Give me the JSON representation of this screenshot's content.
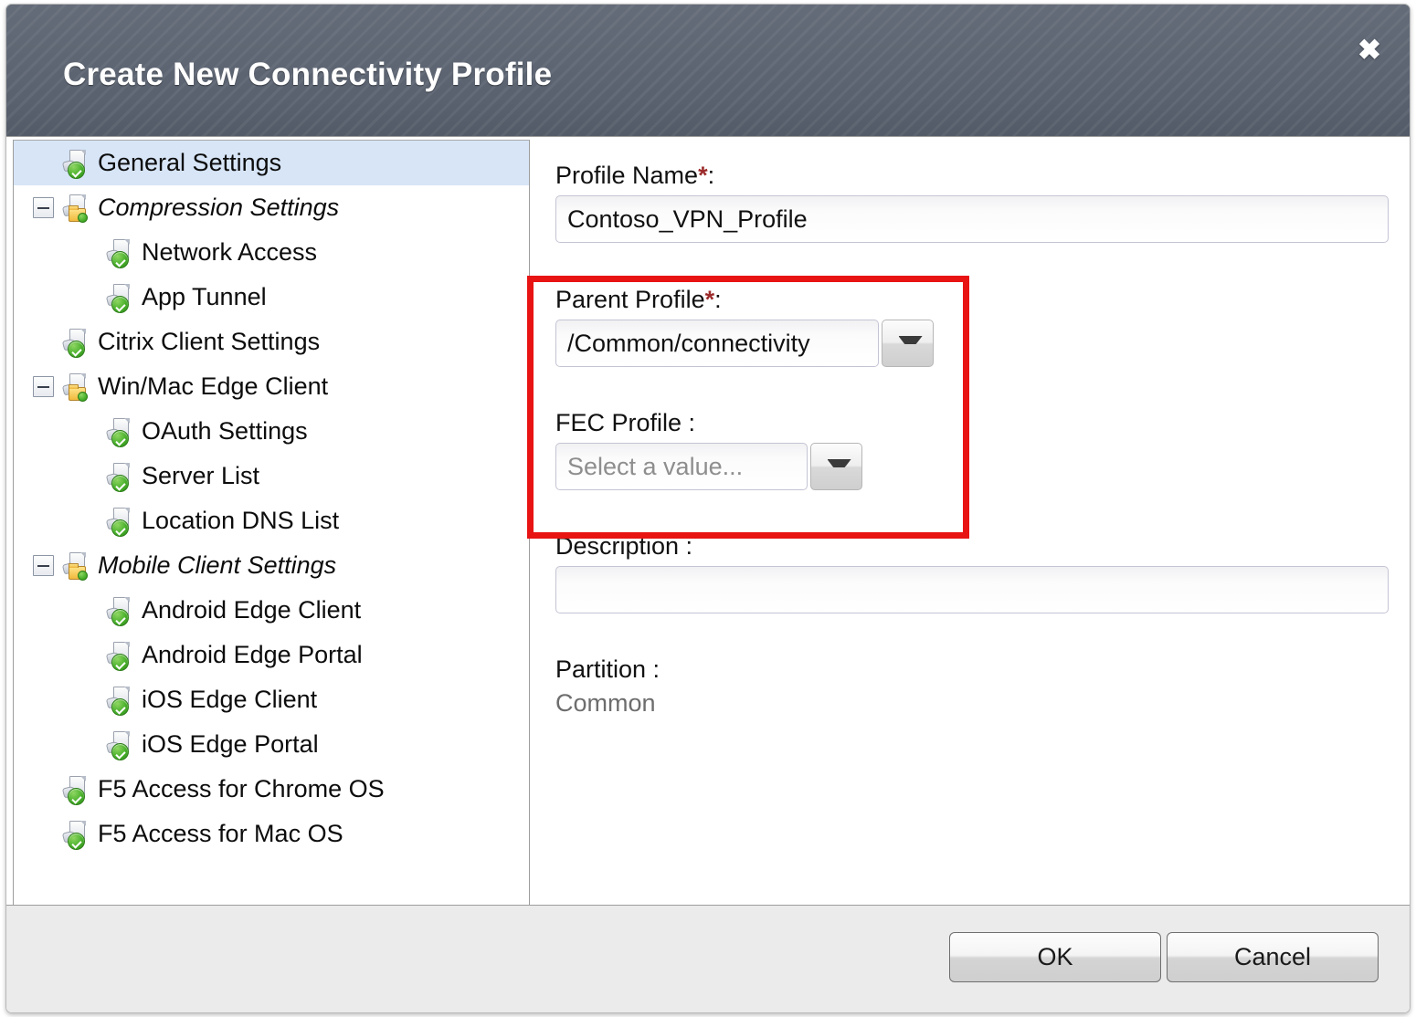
{
  "dialog": {
    "title": "Create New Connectivity Profile",
    "close_icon": "close-x-icon"
  },
  "tree": {
    "items": [
      {
        "label": "General Settings",
        "indent": 0,
        "icon": "page-check-icon",
        "expander": null,
        "selected": true,
        "italic": false
      },
      {
        "label": "Compression Settings",
        "indent": 0,
        "icon": "page-folder-icon",
        "expander": "minus",
        "selected": false,
        "italic": true
      },
      {
        "label": "Network Access",
        "indent": 1,
        "icon": "page-check-icon",
        "expander": null,
        "selected": false,
        "italic": false
      },
      {
        "label": "App Tunnel",
        "indent": 1,
        "icon": "page-check-icon",
        "expander": null,
        "selected": false,
        "italic": false
      },
      {
        "label": "Citrix Client Settings",
        "indent": 0,
        "icon": "page-check-icon",
        "expander": null,
        "selected": false,
        "italic": false
      },
      {
        "label": "Win/Mac Edge Client",
        "indent": 0,
        "icon": "page-folder-icon",
        "expander": "minus",
        "selected": false,
        "italic": false
      },
      {
        "label": "OAuth Settings",
        "indent": 1,
        "icon": "page-check-icon",
        "expander": null,
        "selected": false,
        "italic": false
      },
      {
        "label": "Server List",
        "indent": 1,
        "icon": "page-check-icon",
        "expander": null,
        "selected": false,
        "italic": false
      },
      {
        "label": "Location DNS List",
        "indent": 1,
        "icon": "page-check-icon",
        "expander": null,
        "selected": false,
        "italic": false
      },
      {
        "label": "Mobile Client Settings",
        "indent": 0,
        "icon": "page-folder-icon",
        "expander": "minus",
        "selected": false,
        "italic": true
      },
      {
        "label": "Android Edge Client",
        "indent": 1,
        "icon": "page-check-icon",
        "expander": null,
        "selected": false,
        "italic": false
      },
      {
        "label": "Android Edge Portal",
        "indent": 1,
        "icon": "page-check-icon",
        "expander": null,
        "selected": false,
        "italic": false
      },
      {
        "label": "iOS Edge Client",
        "indent": 1,
        "icon": "page-check-icon",
        "expander": null,
        "selected": false,
        "italic": false
      },
      {
        "label": "iOS Edge Portal",
        "indent": 1,
        "icon": "page-check-icon",
        "expander": null,
        "selected": false,
        "italic": false
      },
      {
        "label": "F5 Access for Chrome OS",
        "indent": 0,
        "icon": "page-check-icon",
        "expander": null,
        "selected": false,
        "italic": false
      },
      {
        "label": "F5 Access for Mac OS",
        "indent": 0,
        "icon": "page-check-icon",
        "expander": null,
        "selected": false,
        "italic": false
      }
    ]
  },
  "form": {
    "profile_name": {
      "label": "Profile Name",
      "required_mark": "*",
      "colon": ":",
      "value": "Contoso_VPN_Profile"
    },
    "parent_profile": {
      "label": "Parent Profile",
      "required_mark": "*",
      "colon": ":",
      "value": "/Common/connectivity",
      "dropdown_icon": "chevron-down-icon"
    },
    "fec_profile": {
      "label": "FEC Profile :",
      "value": "",
      "placeholder": "Select a value...",
      "dropdown_icon": "chevron-down-icon"
    },
    "description": {
      "label": "Description :",
      "value": "",
      "placeholder": ""
    },
    "partition": {
      "label": "Partition :",
      "value": "Common"
    }
  },
  "footer": {
    "ok_label": "OK",
    "cancel_label": "Cancel"
  },
  "colors": {
    "titlebar": "#5b6370",
    "selection": "#d7e5f7",
    "required_asterisk": "#9c2b2b",
    "annotation_box": "#e81313",
    "footer_bg": "#ebebeb"
  }
}
